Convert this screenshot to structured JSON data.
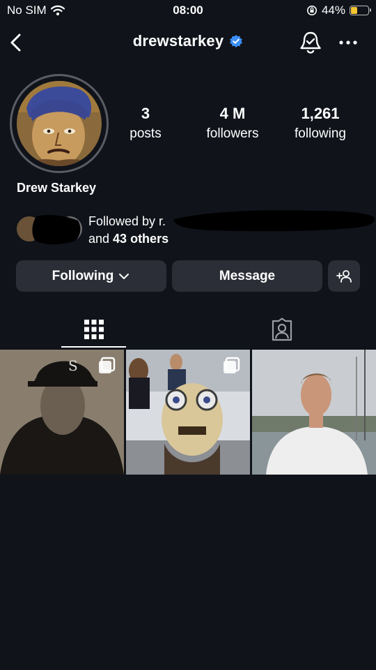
{
  "status_bar": {
    "carrier": "No SIM",
    "time": "08:00",
    "battery_percent": "44%",
    "battery_level": 0.44
  },
  "header": {
    "username": "drewstarkey",
    "verified": true
  },
  "stats": [
    {
      "num": "3",
      "label": "posts"
    },
    {
      "num": "4 M",
      "label": "followers"
    },
    {
      "num": "1,261",
      "label": "following"
    }
  ],
  "profile": {
    "display_name": "Drew Starkey"
  },
  "followed_by": {
    "prefix": "Followed by r.",
    "suffix_pre": "and ",
    "suffix_bold": "43 others"
  },
  "buttons": {
    "following": "Following",
    "message": "Message"
  },
  "tabs": [
    {
      "icon": "grid-icon",
      "active": true
    },
    {
      "icon": "tagged-icon",
      "active": false
    }
  ],
  "colors": {
    "background": "#10131a",
    "button": "#2b2e36",
    "verified": "#3b8ff5",
    "battery": "#f4c531"
  }
}
